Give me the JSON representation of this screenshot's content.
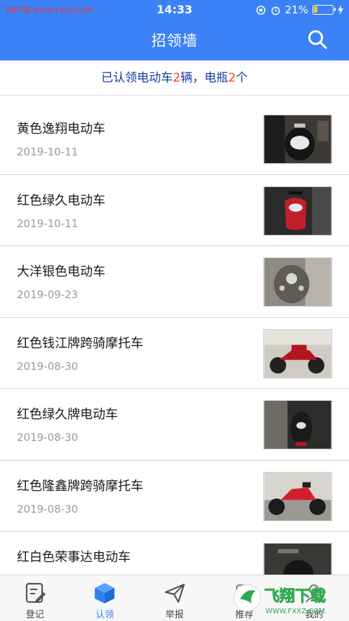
{
  "status_bar": {
    "watermark": "飞翔下载 WWW.FXXZ.COM",
    "time": "14:33",
    "battery": "21%",
    "battery_level": 0.21
  },
  "header": {
    "title": "招领墙",
    "search_icon": "search-icon"
  },
  "summary": {
    "prefix": "已认领电动车",
    "ev_count": "2",
    "mid": "辆，电瓶",
    "battery_count": "2",
    "suffix": "个"
  },
  "items": [
    {
      "name": "黄色逸翔电动车",
      "date": "2019-10-11",
      "photo": "black-scooter-headlight"
    },
    {
      "name": "红色绿久电动车",
      "date": "2019-10-11",
      "photo": "red-scooter"
    },
    {
      "name": "大洋银色电动车",
      "date": "2019-09-23",
      "photo": "grey-scooter-front"
    },
    {
      "name": "红色钱江牌跨骑摩托车",
      "date": "2019-08-30",
      "photo": "red-motorcycle"
    },
    {
      "name": "红色绿久牌电动车",
      "date": "2019-08-30",
      "photo": "red-scooter-dark"
    },
    {
      "name": "红色隆鑫牌跨骑摩托车",
      "date": "2019-08-30",
      "photo": "red-mini-motorcycle"
    },
    {
      "name": "红白色荣事达电动车",
      "date": "",
      "photo": "scooter-partial"
    }
  ],
  "tabs": [
    {
      "label": "登记",
      "icon": "register-icon",
      "active": false
    },
    {
      "label": "认领",
      "icon": "box-icon",
      "active": true
    },
    {
      "label": "举报",
      "icon": "send-icon",
      "active": false
    },
    {
      "label": "推荐",
      "icon": "recommend-icon",
      "active": false
    },
    {
      "label": "我的",
      "icon": "profile-icon",
      "active": false
    }
  ],
  "watermark_badge": {
    "text": "飞翔下载",
    "url_text": "WWW.FXXZ.COM"
  },
  "colors": {
    "accent": "#3a82f5",
    "highlight_number": "#ff3b30",
    "summary_text": "#1a3a9c"
  }
}
